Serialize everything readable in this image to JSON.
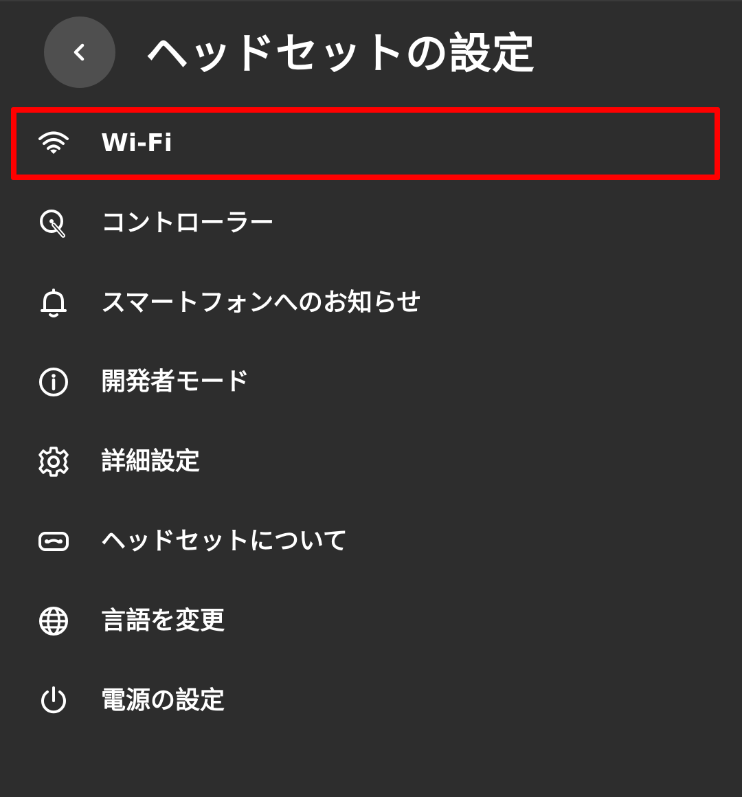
{
  "header": {
    "title": "ヘッドセットの設定",
    "back_icon": "chevron-left-icon"
  },
  "menu": {
    "highlight_color": "#ff0000",
    "items": [
      {
        "label": "Wi-Fi",
        "icon": "wifi-icon",
        "highlighted": true
      },
      {
        "label": "コントローラー",
        "icon": "controller-icon",
        "highlighted": false
      },
      {
        "label": "スマートフォンへのお知らせ",
        "icon": "bell-icon",
        "highlighted": false
      },
      {
        "label": "開発者モード",
        "icon": "info-icon",
        "highlighted": false
      },
      {
        "label": "詳細設定",
        "icon": "gear-icon",
        "highlighted": false
      },
      {
        "label": "ヘッドセットについて",
        "icon": "headset-icon",
        "highlighted": false
      },
      {
        "label": "言語を変更",
        "icon": "globe-icon",
        "highlighted": false
      },
      {
        "label": "電源の設定",
        "icon": "power-icon",
        "highlighted": false
      }
    ]
  }
}
